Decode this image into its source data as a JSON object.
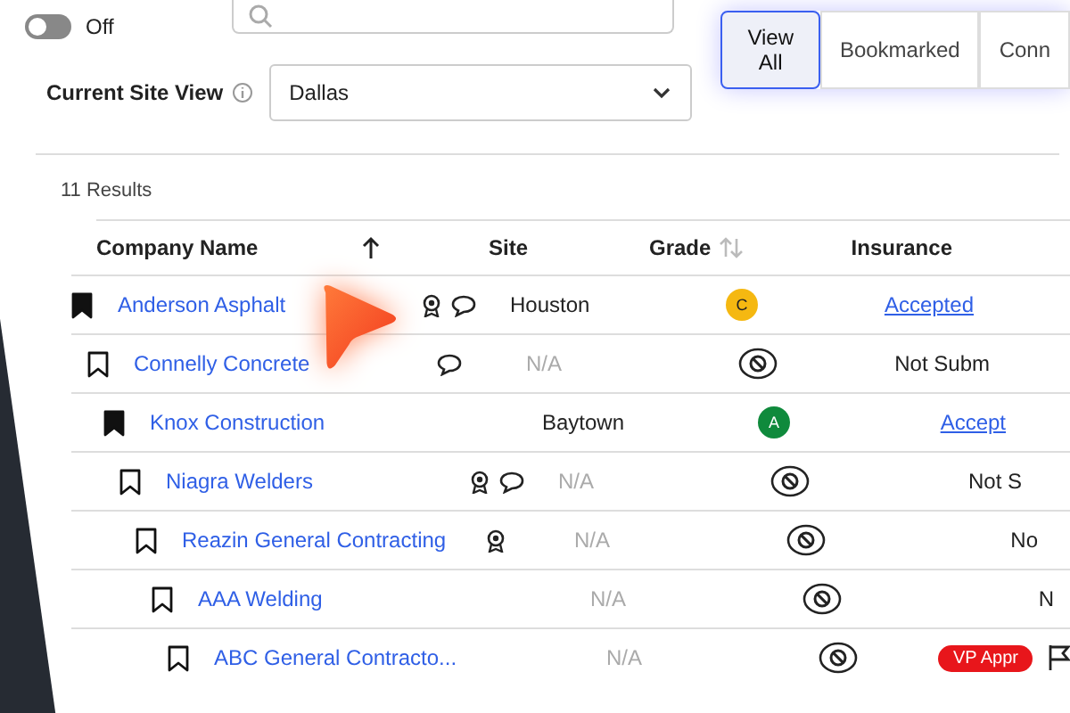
{
  "filters": {
    "toggle": {
      "label": "Off",
      "on": false
    },
    "site_view": {
      "label": "Current Site View",
      "value": "Dallas"
    },
    "tabs": [
      {
        "label": "View All",
        "selected": true
      },
      {
        "label": "Bookmarked",
        "selected": false
      },
      {
        "label": "Conn",
        "selected": false
      }
    ]
  },
  "results": "11 Results",
  "columns": [
    {
      "label": "Company Name",
      "sorted_up": true,
      "sortable": false
    },
    {
      "label": "Site",
      "sorted_up": false,
      "sortable": false
    },
    {
      "label": "Grade",
      "sorted_up": false,
      "sortable": true
    },
    {
      "label": "Insurance",
      "sorted_up": false,
      "sortable": false
    }
  ],
  "rows": [
    {
      "bookmarked": true,
      "name": "Anderson Asphalt",
      "award": true,
      "comment": true,
      "site": "Houston",
      "site_muted": false,
      "grade": {
        "kind": "letter",
        "letter": "C",
        "color": "#f5b811"
      },
      "insurance": {
        "kind": "link",
        "text": "Accepted"
      }
    },
    {
      "bookmarked": false,
      "name": "Connelly Concrete",
      "award": false,
      "comment": true,
      "site": "N/A",
      "site_muted": true,
      "grade": {
        "kind": "none"
      },
      "insurance": {
        "kind": "text",
        "text": "Not Subm"
      }
    },
    {
      "bookmarked": true,
      "name": "Knox Construction",
      "award": false,
      "comment": false,
      "site": "Baytown",
      "site_muted": false,
      "grade": {
        "kind": "letter",
        "letter": "A",
        "color": "#0f8a3c"
      },
      "insurance": {
        "kind": "link",
        "text": "Accept"
      }
    },
    {
      "bookmarked": false,
      "name": "Niagra Welders",
      "award": true,
      "comment": true,
      "site": "N/A",
      "site_muted": true,
      "grade": {
        "kind": "none"
      },
      "insurance": {
        "kind": "text",
        "text": "Not S"
      }
    },
    {
      "bookmarked": false,
      "name": "Reazin General Contracting",
      "award": true,
      "comment": false,
      "site": "N/A",
      "site_muted": true,
      "grade": {
        "kind": "none"
      },
      "insurance": {
        "kind": "text",
        "text": "No"
      }
    },
    {
      "bookmarked": false,
      "name": "AAA Welding",
      "award": false,
      "comment": false,
      "site": "N/A",
      "site_muted": true,
      "grade": {
        "kind": "none"
      },
      "insurance": {
        "kind": "text",
        "text": "N"
      }
    },
    {
      "bookmarked": false,
      "name": "ABC General Contracto...",
      "award": false,
      "comment": false,
      "site": "N/A",
      "site_muted": true,
      "grade": {
        "kind": "none"
      },
      "insurance": {
        "kind": "badge",
        "text": "VP Appr",
        "flag": true
      }
    }
  ]
}
